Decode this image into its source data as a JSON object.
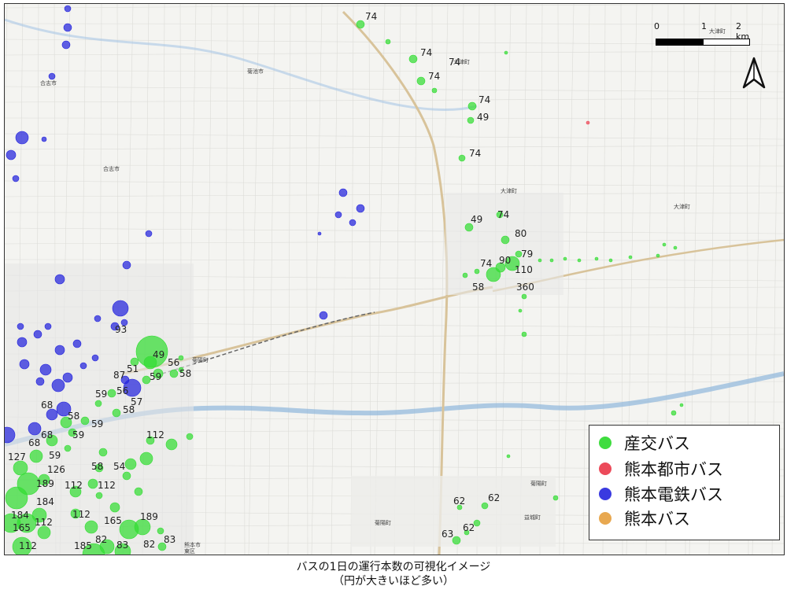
{
  "map": {
    "place_labels": [
      {
        "id": "kikuchi-shi",
        "text": "菊池市"
      },
      {
        "id": "koshi-shi-n",
        "text": "合志市"
      },
      {
        "id": "koshi-shi",
        "text": "合志市"
      },
      {
        "id": "ozu-n",
        "text": "大津町"
      },
      {
        "id": "ozu-e",
        "text": "大津町"
      },
      {
        "id": "ozu-v",
        "text": "大津町"
      },
      {
        "id": "kikuyo",
        "text": "菊陽町"
      },
      {
        "id": "kikuyo-s",
        "text": "菊陽町"
      },
      {
        "id": "kikuyo-se",
        "text": "菊陽町"
      },
      {
        "id": "mashiki",
        "text": "益城町"
      },
      {
        "id": "kumamoto-shi",
        "text": "熊本市"
      },
      {
        "id": "higashi-ku",
        "text": "東区"
      }
    ],
    "stop_labels": [
      "74",
      "74",
      "74",
      "74",
      "74",
      "49",
      "74",
      "49",
      "74",
      "80",
      "74",
      "90",
      "79",
      "110",
      "58",
      "360",
      "93",
      "49",
      "51",
      "87",
      "59",
      "58",
      "56",
      "59",
      "56",
      "57",
      "58",
      "68",
      "58",
      "59",
      "68",
      "59",
      "68",
      "112",
      "127",
      "59",
      "58",
      "54",
      "189",
      "126",
      "112",
      "112",
      "184",
      "112",
      "184",
      "165",
      "189",
      "112",
      "165",
      "112",
      "185",
      "82",
      "83",
      "82",
      "83",
      "62",
      "62",
      "62",
      "63"
    ],
    "operators": {
      "sanko": "#33dd33",
      "toshi": "#ee4455",
      "dentetsu": "#2222dd",
      "kumamoto": "#e8a23a"
    }
  },
  "scale_bar": {
    "tick_0": "0",
    "tick_1": "1",
    "tick_2": "2 km",
    "inline_place": "大津町"
  },
  "legend": {
    "items": [
      {
        "label": "産交バス",
        "color": "#3fdc3f"
      },
      {
        "label": "熊本都市バス",
        "color": "#ec4a5a"
      },
      {
        "label": "熊本電鉄バス",
        "color": "#3a3ae0"
      },
      {
        "label": "熊本バス",
        "color": "#e8a850"
      }
    ]
  },
  "caption": {
    "line1": "バスの1日の運行本数の可視化イメージ",
    "line2": "（円が大きいほど多い）"
  }
}
